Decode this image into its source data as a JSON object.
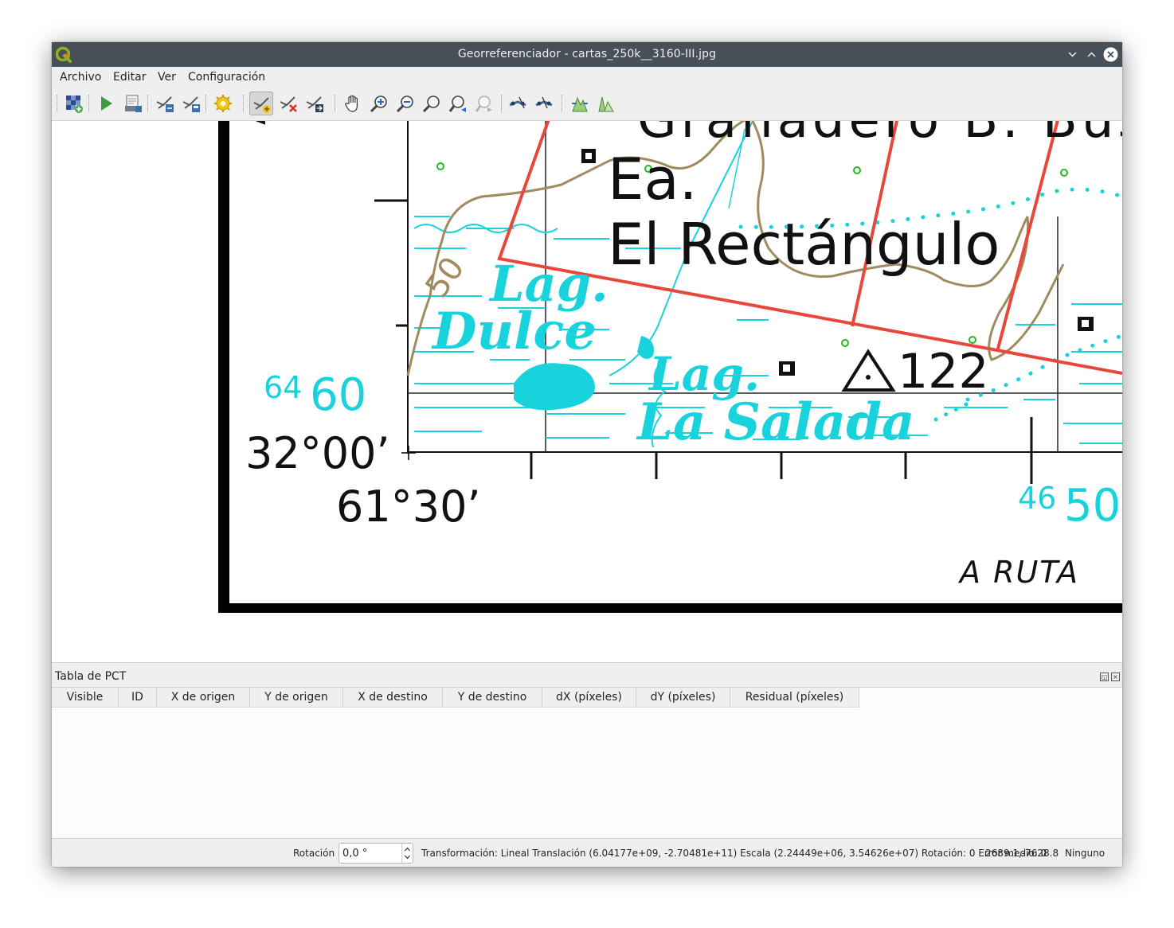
{
  "window": {
    "title": "Georreferenciador - cartas_250k__3160-III.jpg"
  },
  "menu": [
    "Archivo",
    "Editar",
    "Ver",
    "Configuración"
  ],
  "toolbar": {
    "buttons": [
      "open-raster-icon",
      "start-georeferencing-icon",
      "generate-gdal-script-icon",
      "load-gcp-points-icon",
      "save-gcp-points-icon",
      "transformation-settings-icon",
      "add-point-icon",
      "delete-point-icon",
      "move-gcp-point-icon",
      "pan-icon",
      "zoom-in-icon",
      "zoom-out-icon",
      "zoom-to-layer-icon",
      "zoom-last-icon",
      "zoom-next-icon",
      "link-georeferencer-icon",
      "link-qgis-icon",
      "full-histogram-stretch-icon",
      "local-histogram-stretch-icon"
    ],
    "active_tool": "add-point-icon"
  },
  "map": {
    "labels": {
      "top_name": "Granadero B. Bustos",
      "ea": "Ea.",
      "rectangulo": "El Rectángulo",
      "lag1": "Lag.",
      "dulce": "Dulce",
      "lag2": "Lag.",
      "salada": "La Salada",
      "elevation": "122",
      "contour": "50",
      "left_letter": "A",
      "grid_left_small": "64",
      "grid_left_big": "60",
      "lat": "32°00’",
      "lon": "61°30’",
      "grid_right_small": "46",
      "grid_right_big": "50",
      "ruta": "A RUTA"
    },
    "colors": {
      "water": "#19d3dc",
      "road": "#e8473b",
      "contour": "#a08a60",
      "vegetation": "#22b822",
      "frame": "#000000"
    }
  },
  "gcp_table": {
    "title": "Tabla de PCT",
    "columns": [
      "Visible",
      "ID",
      "X de origen",
      "Y de origen",
      "X de destino",
      "Y de destino",
      "dX (píxeles)",
      "dY (píxeles)",
      "Residual (píxeles)"
    ],
    "rows": []
  },
  "status": {
    "rotation_label": "Rotación",
    "rotation_value": "0,0 °",
    "transform": "Transformación: Lineal Translación (6.04177e+09, -2.70481e+11) Escala (2.24449e+06, 3.54626e+07) Rotación: 0 Error medio: 0",
    "coords": "2689.1,-7628.8",
    "crs": "Ninguno"
  }
}
